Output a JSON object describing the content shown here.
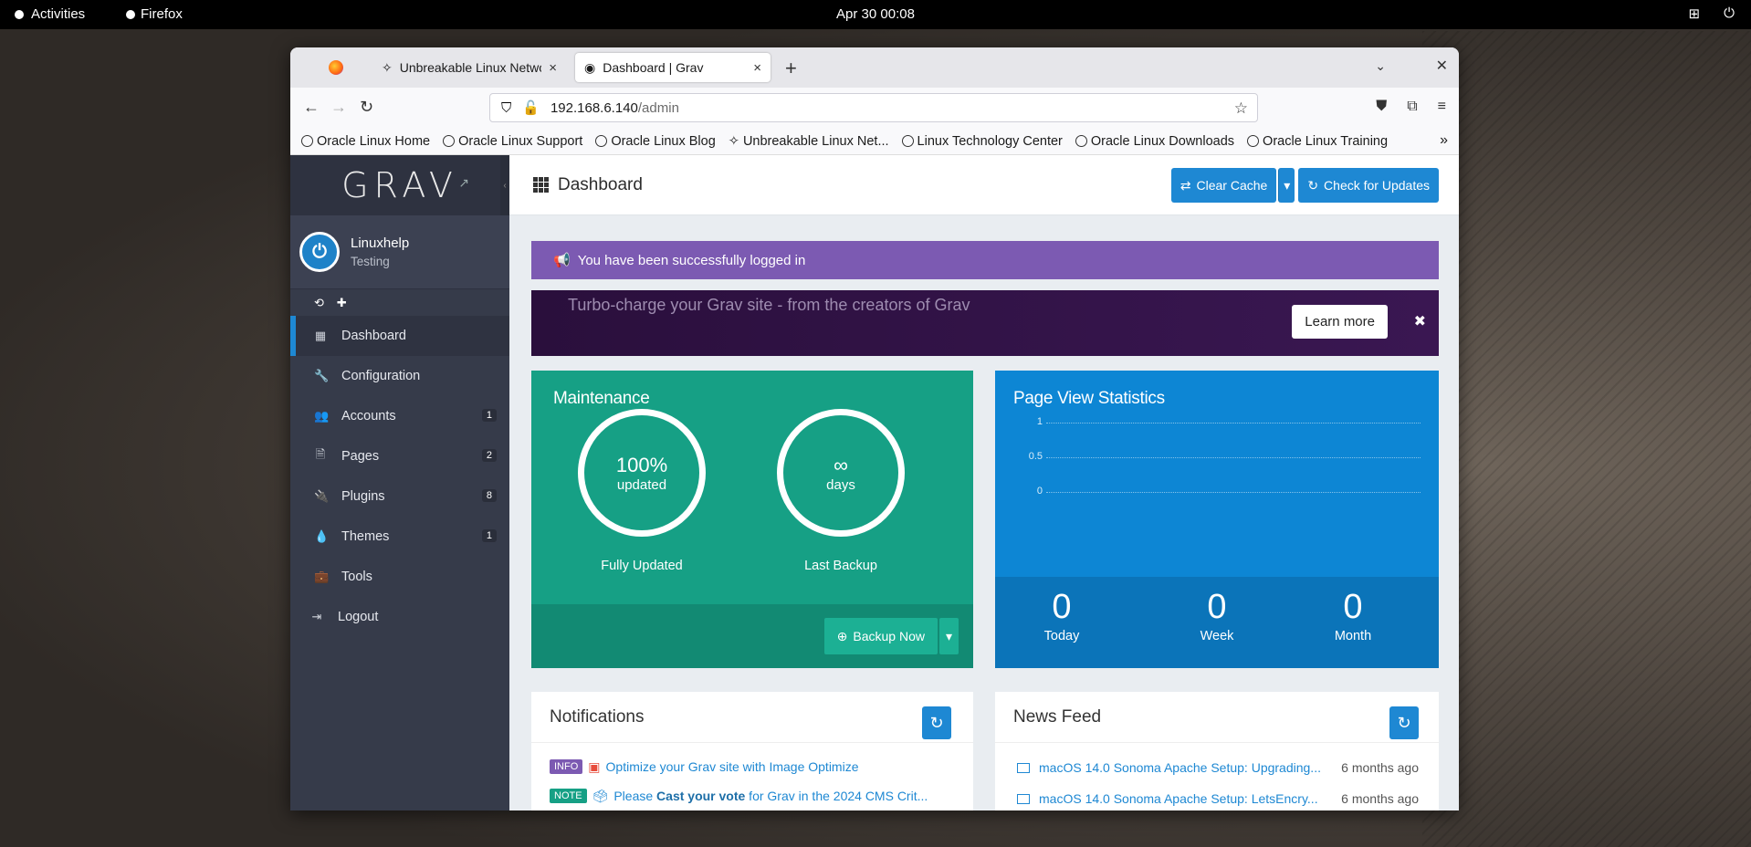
{
  "topbar": {
    "activities": "Activities",
    "app": "Firefox",
    "clock": "Apr 30  00:08"
  },
  "browser": {
    "tabs": [
      {
        "label": "Unbreakable Linux Netwo",
        "active": false
      },
      {
        "label": "Dashboard | Grav",
        "active": true
      }
    ],
    "url_host": "192.168.6.140",
    "url_path": "/admin",
    "bookmarks": [
      "Oracle Linux Home",
      "Oracle Linux Support",
      "Oracle Linux Blog",
      "Unbreakable Linux Net...",
      "Linux Technology Center",
      "Oracle Linux Downloads",
      "Oracle Linux Training"
    ]
  },
  "sidebar": {
    "logo": "GRAV",
    "user_name": "Linuxhelp",
    "user_role": "Testing",
    "items": [
      {
        "label": "Dashboard",
        "icon": "grid-icon",
        "badge": ""
      },
      {
        "label": "Configuration",
        "icon": "wrench-icon",
        "badge": ""
      },
      {
        "label": "Accounts",
        "icon": "users-icon",
        "badge": "1"
      },
      {
        "label": "Pages",
        "icon": "file-icon",
        "badge": "2"
      },
      {
        "label": "Plugins",
        "icon": "plug-icon",
        "badge": "8"
      },
      {
        "label": "Themes",
        "icon": "drop-icon",
        "badge": "1"
      },
      {
        "label": "Tools",
        "icon": "briefcase-icon",
        "badge": ""
      },
      {
        "label": "Logout",
        "icon": "logout-icon",
        "badge": ""
      }
    ]
  },
  "header": {
    "title": "Dashboard",
    "clear_cache": "Clear Cache",
    "check_updates": "Check for Updates"
  },
  "alert": "You have been successfully logged in",
  "promo": {
    "text": "Turbo-charge your Grav site - from the creators of Grav",
    "button": "Learn more"
  },
  "maintenance": {
    "title": "Maintenance",
    "updated_value": "100%",
    "updated_unit": "updated",
    "updated_label": "Fully Updated",
    "backup_value": "∞",
    "backup_unit": "days",
    "backup_label": "Last Backup",
    "backup_button": "Backup Now"
  },
  "stats": {
    "title": "Page View Statistics",
    "ticks": [
      "1",
      "0.5",
      "0"
    ],
    "today_value": "0",
    "today_label": "Today",
    "week_value": "0",
    "week_label": "Week",
    "month_value": "0",
    "month_label": "Month"
  },
  "notifications": {
    "title": "Notifications",
    "items": [
      {
        "tag": "INFO",
        "text": "Optimize your Grav site with Image Optimize"
      },
      {
        "tag": "NOTE",
        "pre": "Please ",
        "bold": "Cast your vote",
        "post": " for Grav in the 2024 CMS Crit..."
      }
    ]
  },
  "newsfeed": {
    "title": "News Feed",
    "items": [
      {
        "text": "macOS 14.0 Sonoma Apache Setup: Upgrading...",
        "ago": "6 months ago"
      },
      {
        "text": "macOS 14.0 Sonoma Apache Setup: LetsEncry...",
        "ago": "6 months ago"
      }
    ]
  },
  "colors": {
    "accent": "#1e88d3",
    "maintenance": "#16a085",
    "stats": "#0d86d4",
    "alert": "#7c5ab2"
  }
}
